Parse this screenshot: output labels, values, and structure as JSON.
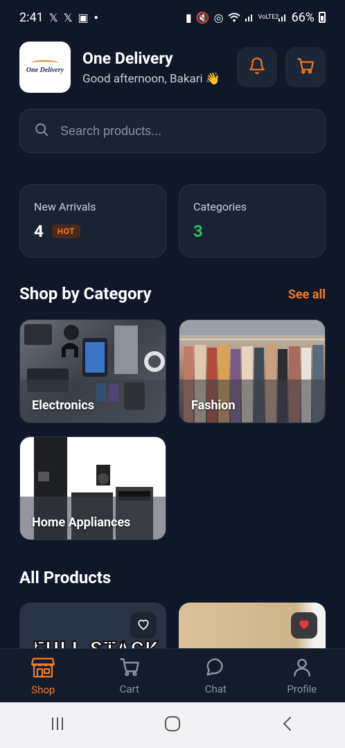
{
  "status_bar": {
    "time": "2:41",
    "battery": "66%",
    "network_label": "VoLTE2"
  },
  "header": {
    "logo_text": "One Delivery",
    "title": "One Delivery",
    "greeting": "Good afternoon, Bakari 👋"
  },
  "search": {
    "placeholder": "Search products..."
  },
  "stats": [
    {
      "label": "New Arrivals",
      "value": "4",
      "badge": "HOT"
    },
    {
      "label": "Categories",
      "value": "3"
    }
  ],
  "shop_by_category": {
    "title": "Shop by Category",
    "see_all": "See all",
    "items": [
      {
        "label": "Electronics"
      },
      {
        "label": "Fashion"
      },
      {
        "label": "Home Appliances"
      }
    ]
  },
  "all_products": {
    "title": "All Products",
    "items": [
      {
        "image_text": "FULL STACK",
        "favorited": false
      },
      {
        "image_text": "",
        "favorited": true
      }
    ]
  },
  "bottom_nav": {
    "items": [
      {
        "label": "Shop",
        "active": true
      },
      {
        "label": "Cart",
        "active": false
      },
      {
        "label": "Chat",
        "active": false
      },
      {
        "label": "Profile",
        "active": false
      }
    ]
  },
  "colors": {
    "background": "#0f1729",
    "card": "#1a2334",
    "accent": "#f07c24",
    "success": "#22c55e"
  }
}
